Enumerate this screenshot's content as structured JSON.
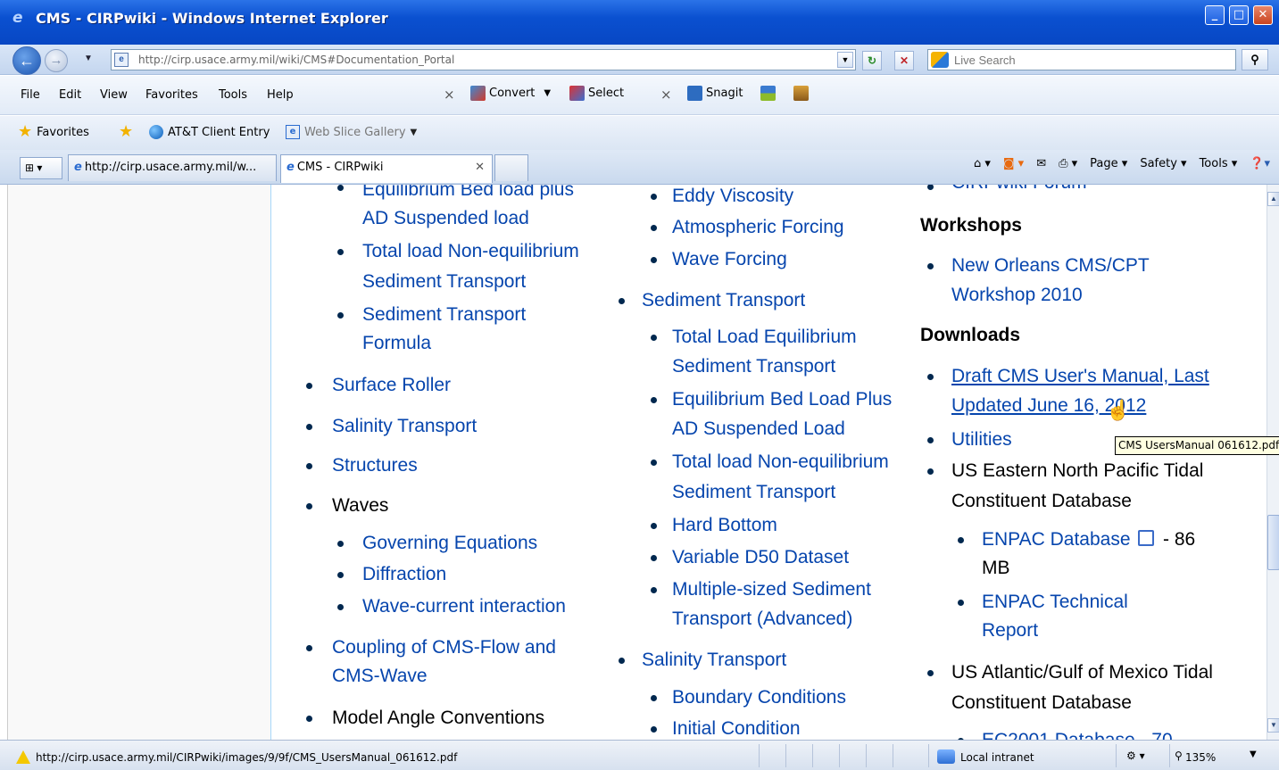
{
  "window": {
    "title": "CMS - CIRPwiki - Windows Internet Explorer"
  },
  "address": {
    "url": "http://cirp.usace.army.mil/wiki/CMS#Documentation_Portal"
  },
  "search": {
    "placeholder": "Live Search"
  },
  "menu": {
    "file": "File",
    "edit": "Edit",
    "view": "View",
    "favorites": "Favorites",
    "tools": "Tools",
    "help": "Help"
  },
  "toolbar": {
    "convert": "Convert",
    "select": "Select",
    "snagit": "Snagit"
  },
  "favbar": {
    "favorites": "Favorites",
    "att": "AT&T Client Entry",
    "webslice": "Web Slice Gallery"
  },
  "tabs": [
    {
      "label": "http://cirp.usace.army.mil/w..."
    },
    {
      "label": "CMS - CIRPwiki"
    }
  ],
  "cmdbar": {
    "page": "Page",
    "safety": "Safety",
    "tools": "Tools"
  },
  "col1": {
    "cut_top": "Equilibrium Bed load plus",
    "items": [
      "AD Suspended load",
      "Total load Non-equilibrium",
      "Sediment Transport",
      "Sediment Transport",
      "Formula",
      "Surface Roller",
      "Salinity Transport",
      "Structures",
      "Waves",
      "Governing Equations",
      "Diffraction",
      "Wave-current interaction",
      "Coupling of CMS-Flow and",
      "CMS-Wave",
      "Model Angle Conventions"
    ]
  },
  "col2": {
    "items": [
      "Eddy Viscosity",
      "Atmospheric Forcing",
      "Wave Forcing",
      "Sediment Transport",
      "Total Load Equilibrium",
      "Sediment Transport",
      "Equilibrium Bed Load Plus",
      "AD Suspended Load",
      "Total load Non-equilibrium",
      "Sediment Transport",
      "Hard Bottom",
      "Variable D50 Dataset",
      "Multiple-sized Sediment",
      "Transport (Advanced)",
      "Salinity Transport",
      "Boundary Conditions",
      "Initial Condition"
    ]
  },
  "col3": {
    "cut_top": "CIRPwiki Forum",
    "workshops_heading": "Workshops",
    "workshop_line1": "New Orleans CMS/CPT",
    "workshop_line2": "Workshop 2010",
    "downloads_heading": "Downloads",
    "manual_line1": "Draft CMS User's Manual, Last",
    "manual_line2": "Updated June 16, 2012",
    "utilities": "Utilities",
    "enpac_db_line1": "US Eastern North Pacific Tidal",
    "enpac_db_line2": "Constituent Database",
    "enpac_link": "ENPAC Database",
    "enpac_size_a": "- 86",
    "enpac_size_b": "MB",
    "enpac_tech_line1": "ENPAC Technical",
    "enpac_tech_line2": "Report",
    "gulf_line1": "US Atlantic/Gulf of Mexico Tidal",
    "gulf_line2": "Constituent Database",
    "cut_bottom": "EC2001 Database  - 70"
  },
  "tooltip": {
    "text": "CMS UsersManual 061612.pdf"
  },
  "status": {
    "url": "http://cirp.usace.army.mil/CIRPwiki/images/9/9f/CMS_UsersManual_061612.pdf",
    "zone": "Local intranet",
    "zoom": "135%"
  }
}
